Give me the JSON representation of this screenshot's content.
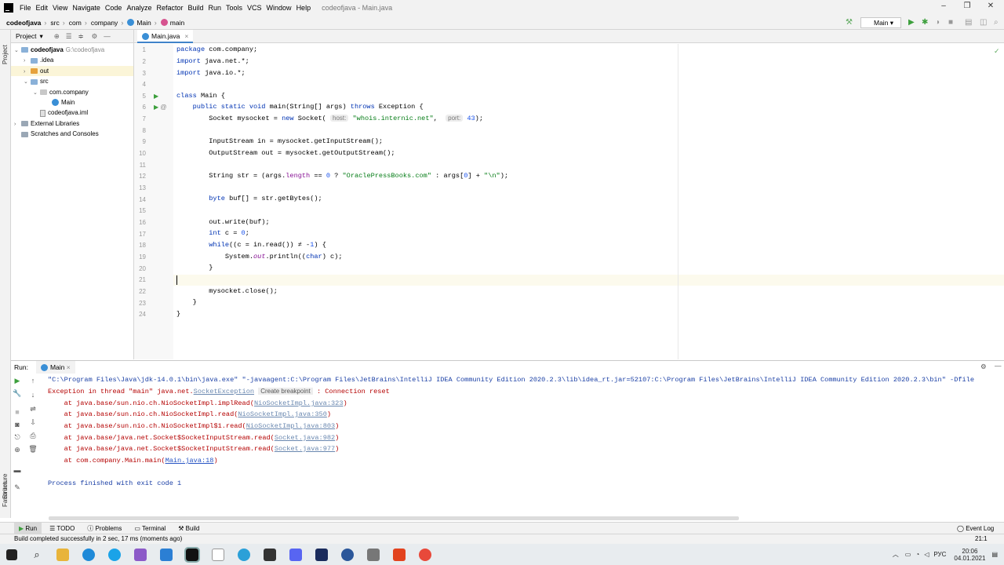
{
  "menubar": {
    "items": [
      "File",
      "Edit",
      "View",
      "Navigate",
      "Code",
      "Analyze",
      "Refactor",
      "Build",
      "Run",
      "Tools",
      "VCS",
      "Window",
      "Help"
    ],
    "window_title": "codeofjava - Main.java",
    "min": "–",
    "max": "❐",
    "close": "✕"
  },
  "navbar": {
    "crumbs": [
      "codeofjava",
      "src",
      "com",
      "company",
      "Main",
      "main"
    ],
    "run_config": "Main"
  },
  "project": {
    "header": "Project",
    "tree": [
      {
        "label": "codeofjava",
        "path": "G:\\codeofjava"
      },
      {
        "label": ".idea"
      },
      {
        "label": "out"
      },
      {
        "label": "src"
      },
      {
        "label": "com.company"
      },
      {
        "label": "Main"
      },
      {
        "label": "codeofjava.iml"
      },
      {
        "label": "External Libraries"
      },
      {
        "label": "Scratches and Consoles"
      }
    ]
  },
  "strips": {
    "project": "Project",
    "structure": "Structure",
    "favorites": "Favorites"
  },
  "editor": {
    "tab": "Main.java",
    "line_numbers": [
      "1",
      "2",
      "3",
      "4",
      "5",
      "6",
      "7",
      "8",
      "9",
      "10",
      "11",
      "12",
      "13",
      "14",
      "15",
      "16",
      "17",
      "18",
      "19",
      "20",
      "21",
      "22",
      "23",
      "24"
    ],
    "code": {
      "l1a": "package",
      "l1b": " com.company;",
      "l2a": "import",
      "l2b": " java.net.*;",
      "l3a": "import",
      "l3b": " java.io.*;",
      "l5a": "class",
      "l5b": " Main {",
      "l6a": "    public static void",
      "l6b": " main(String[] args) ",
      "l6c": "throws",
      "l6d": " Exception {",
      "l7a": "        Socket mysocket = ",
      "l7b": "new",
      "l7c": " Socket( ",
      "l7h1": "host:",
      "l7d": " ",
      "l7s": "\"whois.internic.net\"",
      "l7e": ",  ",
      "l7h2": "port:",
      "l7f": " ",
      "l7n": "43",
      "l7g": ");",
      "l9": "        InputStream in = mysocket.getInputStream();",
      "l10": "        OutputStream out = mysocket.getOutputStream();",
      "l12a": "        String str = (args.",
      "l12b": "length",
      "l12c": " == ",
      "l12d": "0",
      "l12e": " ? ",
      "l12f": "\"OraclePressBooks.com\"",
      "l12g": " : args[",
      "l12h": "0",
      "l12i": "] + ",
      "l12j": "\"\\n\"",
      "l12k": ");",
      "l14a": "        ",
      "l14b": "byte",
      "l14c": " buf[] = str.getBytes();",
      "l16": "        out.write(buf);",
      "l17a": "        ",
      "l17b": "int",
      "l17c": " c = ",
      "l17d": "0",
      "l17e": ";",
      "l18a": "        ",
      "l18b": "while",
      "l18c": "((c = in.read()) ≠ -",
      "l18d": "1",
      "l18e": ") {",
      "l19a": "            System.",
      "l19b": "out",
      "l19c": ".println((",
      "l19d": "char",
      "l19e": ") c);",
      "l20": "        }",
      "l22": "        mysocket.close();",
      "l23": "    }",
      "l24": "}"
    }
  },
  "run": {
    "label": "Run:",
    "tab": "Main",
    "cmd": "\"C:\\Program Files\\Java\\jdk-14.0.1\\bin\\java.exe\" \"-javaagent:C:\\Program Files\\JetBrains\\IntelliJ IDEA Community Edition 2020.2.3\\lib\\idea_rt.jar=52107:C:\\Program Files\\JetBrains\\IntelliJ IDEA Community Edition 2020.2.3\\bin\" -Dfile",
    "exc_a": "Exception in thread \"main\" java.net.",
    "exc_link": "SocketException",
    "exc_bp": "Create breakpoint",
    "exc_b": " : Connection reset",
    "trace": [
      {
        "text": "    at java.base/sun.nio.ch.NioSocketImpl.implRead(",
        "link": "NioSocketImpl.java:323"
      },
      {
        "text": "    at java.base/sun.nio.ch.NioSocketImpl.read(",
        "link": "NioSocketImpl.java:350"
      },
      {
        "text": "    at java.base/sun.nio.ch.NioSocketImpl$1.read(",
        "link": "NioSocketImpl.java:803"
      },
      {
        "text": "    at java.base/java.net.Socket$SocketInputStream.read(",
        "link": "Socket.java:982"
      },
      {
        "text": "    at java.base/java.net.Socket$SocketInputStream.read(",
        "link": "Socket.java:977"
      },
      {
        "text": "    at com.company.Main.main(",
        "link": "Main.java:18"
      }
    ],
    "close_paren": ")",
    "finished": "Process finished with exit code 1"
  },
  "bottom_tabs": [
    "Run",
    "TODO",
    "Problems",
    "Terminal",
    "Build"
  ],
  "event_log": "Event Log",
  "status": {
    "message": "Build completed successfully in 2 sec, 17 ms (moments ago)",
    "position": "21:1"
  },
  "taskbar": {
    "lang": "РУС",
    "time": "20:06",
    "date": "04.01.2021"
  },
  "colors": {
    "accent": "#4083c9",
    "run_green": "#3c9f3c",
    "error_red": "#b40000"
  }
}
